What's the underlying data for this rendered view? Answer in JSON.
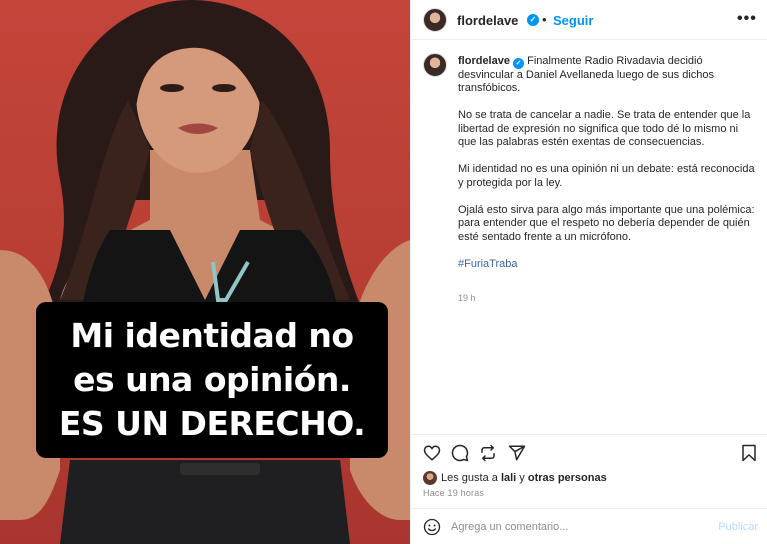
{
  "post": {
    "username": "flordelave",
    "follow_label": "Seguir",
    "more_icon": "•••",
    "verified_icon": "✓"
  },
  "image": {
    "caption_lines": [
      "Mi identidad no",
      "es una opinión.",
      "ES UN DERECHO."
    ],
    "colors": {
      "wall": "#b73d33",
      "box": "#000000",
      "text": "#ffffff"
    }
  },
  "caption": {
    "username": "flordelave",
    "first": "Finalmente Radio Rivadavia decidió desvincular a Daniel Avellaneda luego de sus dichos transfóbicos.",
    "p2": "No se trata de cancelar a nadie. Se trata de entender que la libertad de expresión no significa que todo dé lo mismo ni que las palabras estén exentas de consecuencias.",
    "p3": "Mi identidad no es una opinión ni un debate: está reconocida y protegida por la ley.",
    "p4": "Ojalá esto sirva para algo más importante que una polémica: para entender que el respeto no debería depender de quién esté sentado frente a un micrófono.",
    "hashtag": "#FuriaTraba",
    "time": "19 h"
  },
  "likes": {
    "prefix": "Les gusta a",
    "user": "lali",
    "middle": "y",
    "others": "otras personas"
  },
  "ago": "Hace 19 horas",
  "comment": {
    "placeholder": "Agrega un comentario...",
    "publish_label": "Publicar"
  },
  "icons": [
    "heart-icon",
    "comment-icon",
    "repost-icon",
    "share-icon",
    "bookmark-icon",
    "emoji-icon"
  ],
  "accent_color": "#0095f6"
}
